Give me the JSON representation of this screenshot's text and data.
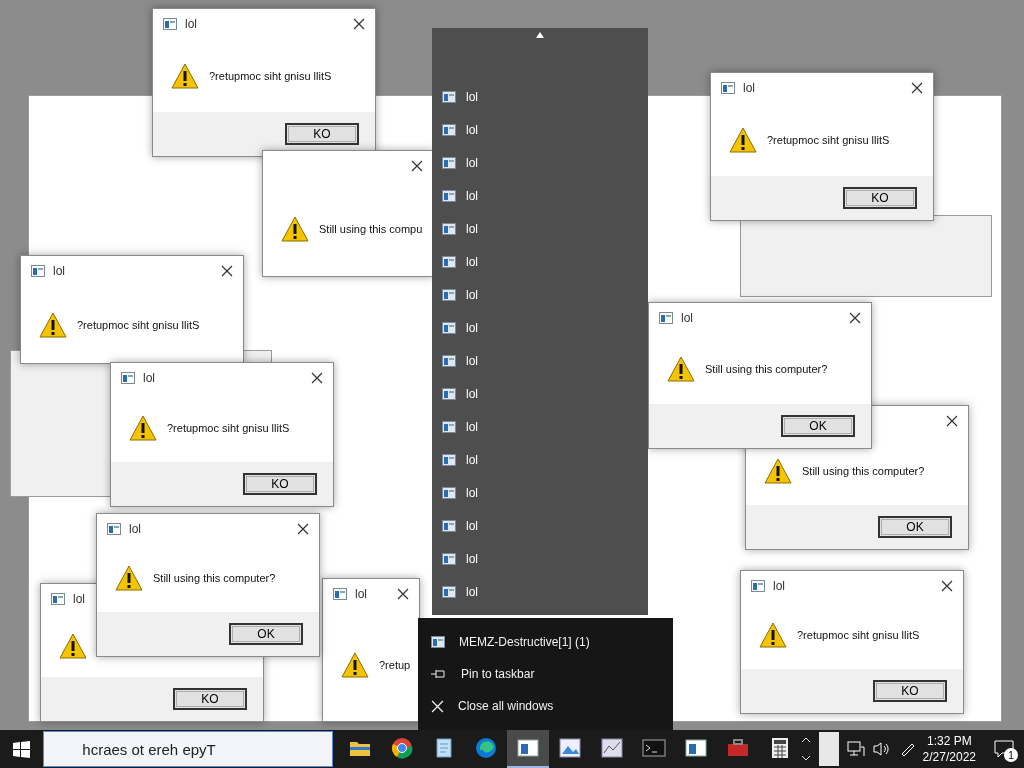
{
  "dialogs": [
    {
      "title": "lol",
      "message": "?retupmoc siht gnisu llitS",
      "button": "KO"
    },
    {
      "message": "Still using this compu"
    },
    {
      "title": "lol",
      "message": "?retup"
    },
    {
      "title": "lol",
      "message": "?retupmoc siht gnisu llitS",
      "button": "KO"
    },
    {
      "title": "lol",
      "message": "?retupmoc siht gnisu llitS"
    },
    {
      "title": "lol",
      "message": "?retupmoc siht gnisu llitS",
      "button": "KO"
    },
    {
      "message": "Still using this computer?",
      "button": "OK"
    },
    {
      "title": "lol",
      "message": "Still using this computer?",
      "button": "OK"
    },
    {
      "title": "lol",
      "button": "KO"
    },
    {
      "title": "lol",
      "message": "Still using this computer?",
      "button": "OK"
    },
    {
      "title": "lol",
      "message": "?retupmoc siht gnisu llitS",
      "button": "KO"
    }
  ],
  "jump_list": {
    "items": [
      {
        "title": "lol"
      },
      {
        "title": "lol"
      },
      {
        "title": "lol"
      },
      {
        "title": "lol"
      },
      {
        "title": "lol"
      },
      {
        "title": "lol"
      },
      {
        "title": "lol"
      },
      {
        "title": "lol"
      },
      {
        "title": "lol"
      },
      {
        "title": "lol"
      },
      {
        "title": "lol"
      },
      {
        "title": "lol"
      },
      {
        "title": "lol"
      },
      {
        "title": "lol"
      },
      {
        "title": "lol"
      },
      {
        "title": "lol"
      }
    ]
  },
  "context_menu": [
    {
      "kind": "app",
      "label": "MEMZ-Destructive[1] (1)"
    },
    {
      "kind": "pin",
      "label": "Pin to taskbar"
    },
    {
      "kind": "close",
      "label": "Close all windows"
    }
  ],
  "taskbar": {
    "search": {
      "placeholder": "hcraes ot ereh epyT"
    },
    "apps": [
      {
        "kind": "folder",
        "selected": false
      },
      {
        "kind": "ball",
        "selected": false
      },
      {
        "kind": "notepad",
        "selected": false
      },
      {
        "kind": "swirl",
        "selected": false
      },
      {
        "kind": "window",
        "selected": true
      },
      {
        "kind": "picture",
        "selected": false
      },
      {
        "kind": "chart",
        "selected": false
      },
      {
        "kind": "terminal",
        "selected": false
      },
      {
        "kind": "window",
        "selected": false
      },
      {
        "kind": "toolbox",
        "selected": false
      },
      {
        "kind": "calculator",
        "selected": false
      }
    ],
    "time": "1:32 PM",
    "date": "2/27/2022",
    "notifications": "1"
  }
}
